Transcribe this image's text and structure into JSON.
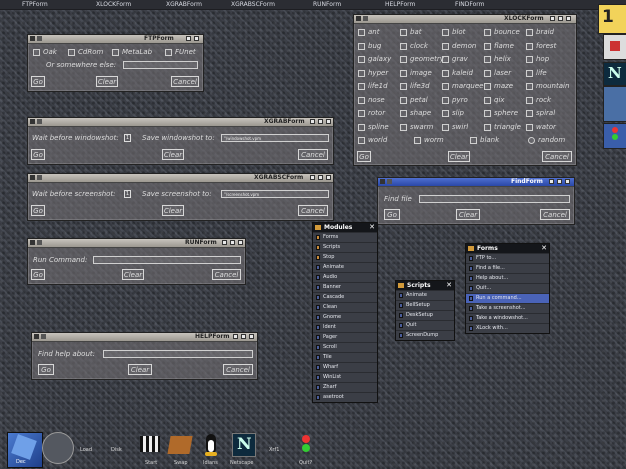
{
  "topbar": {
    "items": [
      "FTPForm",
      "XLOCKForm",
      "XGRABForm",
      "XGRABSCForm",
      "RUNForm",
      "HELPForm",
      "FINDForm"
    ]
  },
  "desk_number": "1",
  "ftp": {
    "title": "FTPForm",
    "options": [
      "Oak",
      "CdRom",
      "MetaLab",
      "FUnet"
    ],
    "somewhere_label": "Or somewhere else:",
    "go": "Go",
    "clear": "Clear",
    "cancel": "Cancel"
  },
  "xlock": {
    "title": "XLOCKForm",
    "modes": [
      [
        "ant",
        "bat",
        "blot",
        "bounce",
        "braid"
      ],
      [
        "bug",
        "clock",
        "demon",
        "flame",
        "forest"
      ],
      [
        "galaxy",
        "geometry",
        "grav",
        "helix",
        "hop"
      ],
      [
        "hyper",
        "image",
        "kaleid",
        "laser",
        "life"
      ],
      [
        "life1d",
        "life3d",
        "marquee",
        "maze",
        "mountain"
      ],
      [
        "nose",
        "petal",
        "pyro",
        "qix",
        "rock"
      ],
      [
        "rotor",
        "shape",
        "slip",
        "sphere",
        "spiral"
      ],
      [
        "spline",
        "swarm",
        "swirl",
        "triangle",
        "wator"
      ],
      [
        "world",
        "worm",
        "blank",
        "random"
      ]
    ],
    "go": "Go",
    "clear": "Clear",
    "cancel": "Cancel"
  },
  "xgrab": {
    "title": "XGRABForm",
    "wait_label": "Wait before windowshot:",
    "wait_value": "1",
    "save_label": "Save windowshot to:",
    "save_value": "\"/windowshot.vpm",
    "go": "Go",
    "clear": "Clear",
    "cancel": "Cancel"
  },
  "xgrabsc": {
    "title": "XGRABSCForm",
    "wait_label": "Wait before screenshot:",
    "wait_value": "1",
    "save_label": "Save screenshot to:",
    "save_value": "\"/screenshot.vpm",
    "go": "Go",
    "clear": "Clear",
    "cancel": "Cancel"
  },
  "find": {
    "title": "FindForm",
    "file_label": "Find file",
    "go": "Go",
    "clear": "Clear",
    "cancel": "Cancel"
  },
  "run": {
    "title": "RUNForm",
    "cmd_label": "Run Command:",
    "go": "Go",
    "clear": "Clear",
    "cancel": "Cancel"
  },
  "help": {
    "title": "HELPForm",
    "about_label": "Find help about:",
    "go": "Go",
    "clear": "Clear",
    "cancel": "Cancel"
  },
  "modules_menu": {
    "title": "Modules",
    "items": [
      "Forms",
      "Scripts",
      "Stop",
      "Animate",
      "Audio",
      "Banner",
      "Cascade",
      "Clean",
      "Gnome",
      "Ident",
      "Pager",
      "Scroll",
      "Tile",
      "Wharf",
      "WinList",
      "Zharf",
      "asetroot"
    ]
  },
  "scripts_menu": {
    "title": "Scripts",
    "items": [
      "Animate",
      "BellSetup",
      "DeskSetup",
      "Quit",
      "ScreenDump"
    ]
  },
  "forms_menu": {
    "title": "Forms",
    "items": [
      "FTP to...",
      "Find a file...",
      "Help about...",
      "Quit...",
      "Run a command...",
      "Take a screenshot...",
      "Take a windowshot...",
      "XLock with..."
    ],
    "selected": "Run a command..."
  },
  "dock": {
    "labels": [
      "Dec",
      "Load",
      "Disk",
      "Start",
      "Swap",
      "Idians",
      "Netscape",
      "Xrf1",
      "Quit?"
    ]
  },
  "colors": {
    "menu_highlight": "#4a63b8",
    "menu_header": "#14161a",
    "desk_badge": "#f2d35a"
  }
}
